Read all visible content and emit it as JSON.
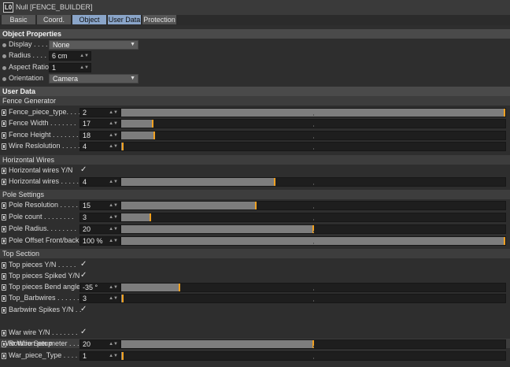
{
  "title": "Null [FENCE_BUILDER]",
  "icon_letters": "L0",
  "tabs": [
    "Basic",
    "Coord.",
    "Object",
    "User Data",
    "Protection"
  ],
  "object_properties": {
    "header": "Object Properties",
    "display": {
      "label": "Display . . . . .",
      "value": "None"
    },
    "radius": {
      "label": "Radius . . . . .",
      "value": "6 cm"
    },
    "aspect_ratio": {
      "label": "Aspect Ratio",
      "value": "1"
    },
    "orientation": {
      "label": "Orientation",
      "value": "Camera"
    }
  },
  "user_data": {
    "header": "User Data",
    "groups": [
      {
        "name": "Fence Generator",
        "rows": [
          {
            "label": "Fence_piece_type. . . . .",
            "value": "2",
            "slider": 1.0
          },
          {
            "label": "Fence Width . . . . . . .",
            "value": "17",
            "slider": 0.08
          },
          {
            "label": "Fence Height . . . . . . .",
            "value": "18",
            "slider": 0.085
          },
          {
            "label": "Wire Reslolution . . . . .",
            "value": "4",
            "slider": 0.0
          }
        ]
      },
      {
        "name": "Horizontal Wires",
        "rows": [
          {
            "label": "Horizontal wires Y/N",
            "check": true
          },
          {
            "label": "Horizontal wires . . . . .",
            "value": "4",
            "slider": 0.4
          }
        ]
      },
      {
        "name": "Pole Settings",
        "rows": [
          {
            "label": "Pole Resolution . . . . .",
            "value": "15",
            "slider": 0.35
          },
          {
            "label": "Pole count . . . . . . . .",
            "value": "3",
            "slider": 0.075
          },
          {
            "label": "Pole Radius. . . . . . . .",
            "value": "20",
            "slider": 0.5
          },
          {
            "label": "Pole Offset Front/back",
            "value": "100 %",
            "slider": 1.0
          }
        ]
      },
      {
        "name": "Top Section",
        "rows": [
          {
            "label": "Top pieces Y/N . . . . .",
            "check": true
          },
          {
            "label": "Top pieces Spiked Y/N",
            "check": true
          },
          {
            "label": "Top pieces Bend angle",
            "value": "-35 °",
            "slider": 0.15
          },
          {
            "label": "Top_Barbwires . . . . . .",
            "value": "3",
            "slider": 0.0
          },
          {
            "label": "Barbwire Spikes Y/N . .",
            "check": true
          }
        ]
      },
      {
        "name": "War Wire Setup",
        "rows": [
          {
            "label": "War wire Y/N . . . . . . .",
            "check": true
          },
          {
            "label": "Rotation per meter . . .",
            "value": "20",
            "slider": 0.5
          },
          {
            "label": "War_piece_Type . . . . .",
            "value": "1",
            "slider": 0.0
          }
        ]
      }
    ]
  },
  "colors": {
    "accent_tab": "#8aa5c9",
    "slider_handle": "#f0a020"
  }
}
